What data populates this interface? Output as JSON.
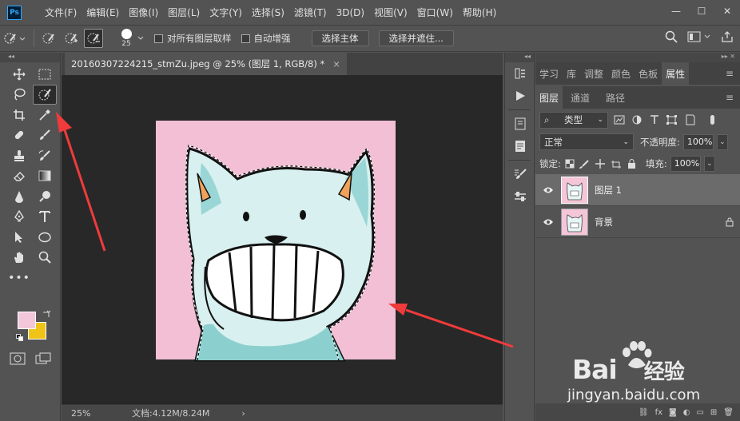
{
  "app": {
    "logo": "Ps"
  },
  "menu": [
    "文件(F)",
    "编辑(E)",
    "图像(I)",
    "图层(L)",
    "文字(Y)",
    "选择(S)",
    "滤镜(T)",
    "3D(D)",
    "视图(V)",
    "窗口(W)",
    "帮助(H)"
  ],
  "window_controls": {
    "minimize": "—",
    "restore": "☐",
    "close": "✕"
  },
  "options": {
    "brush_size": "25",
    "sample_all_layers": "对所有图层取样",
    "auto_enhance": "自动增强",
    "select_subject": "选择主体",
    "select_and_mask": "选择并遮住..."
  },
  "document": {
    "tab_title": "20160307224215_stmZu.jpeg @ 25% (图层 1, RGB/8) *",
    "close": "×",
    "zoom": "25%",
    "doc_info": "文档:4.12M/8.24M",
    "status_arrow": "›"
  },
  "colors": {
    "foreground": "#f2c7da",
    "background": "#f0c319",
    "canvas_pink": "#f2bfd4",
    "cat_fill": "#d8f0ef",
    "cat_shade": "#73c2c4",
    "ear": "#f0a25a",
    "arrow": "#ef3b3b"
  },
  "panels": {
    "top_tabs": [
      "学习",
      "库",
      "调整",
      "颜色",
      "色板",
      "属性"
    ],
    "active_top_tab": "属性",
    "layer_tabs": [
      "图层",
      "通道",
      "路径"
    ],
    "filter_kind": "类型",
    "blend_mode": "正常",
    "opacity_label": "不透明度:",
    "opacity_value": "100%",
    "lock_label": "锁定:",
    "fill_label": "填充:",
    "fill_value": "100%",
    "layers": [
      {
        "name": "图层 1",
        "selected": true
      },
      {
        "name": "背景",
        "selected": false
      }
    ],
    "footer_fx": "fx"
  },
  "watermark": {
    "brand": "Bai",
    "brand2": "经验",
    "url": "jingyan.baidu.com"
  }
}
